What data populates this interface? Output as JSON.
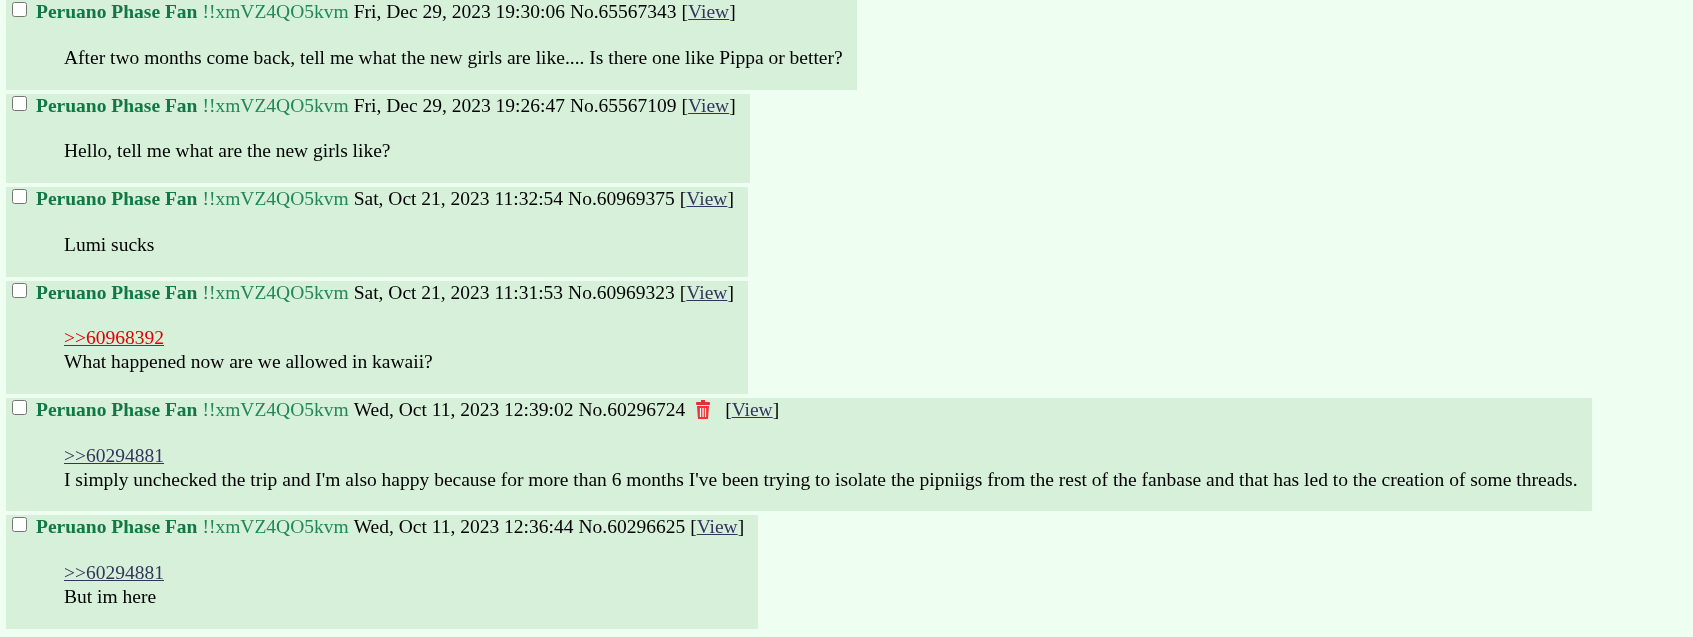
{
  "posts": [
    {
      "checked": false,
      "name": "Peruano Phase Fan",
      "trip": "!!xmVZ4QO5kvm",
      "datetime": "Fri, Dec 29, 2023 19:30:06",
      "number": "No.65567343",
      "deleted": false,
      "view": {
        "open": "[",
        "label": "View",
        "close": "]"
      },
      "message": "After two months come back, tell me what the new girls are like.... Is there one like Pippa or better?"
    },
    {
      "checked": false,
      "name": "Peruano Phase Fan",
      "trip": "!!xmVZ4QO5kvm",
      "datetime": "Fri, Dec 29, 2023 19:26:47",
      "number": "No.65567109",
      "deleted": false,
      "view": {
        "open": "[",
        "label": "View",
        "close": "]"
      },
      "message": "Hello, tell me what are the new girls like?"
    },
    {
      "checked": false,
      "name": "Peruano Phase Fan",
      "trip": "!!xmVZ4QO5kvm",
      "datetime": "Sat, Oct 21, 2023 11:32:54",
      "number": "No.60969375",
      "deleted": false,
      "view": {
        "open": "[",
        "label": "View",
        "close": "]"
      },
      "message": "Lumi sucks"
    },
    {
      "checked": false,
      "name": "Peruano Phase Fan",
      "trip": "!!xmVZ4QO5kvm",
      "datetime": "Sat, Oct 21, 2023 11:31:53",
      "number": "No.60969323",
      "deleted": false,
      "view": {
        "open": "[",
        "label": "View",
        "close": "]"
      },
      "quotes": [
        {
          "text": ">>60968392",
          "dead": true
        }
      ],
      "message": "What happened now are we allowed in kawaii?"
    },
    {
      "checked": false,
      "name": "Peruano Phase Fan",
      "trip": "!!xmVZ4QO5kvm",
      "datetime": "Wed, Oct 11, 2023 12:39:02",
      "number": "No.60296724",
      "deleted": true,
      "view": {
        "open": "[",
        "label": "View",
        "close": "]"
      },
      "quotes": [
        {
          "text": ">>60294881",
          "dead": false
        }
      ],
      "message": "I simply unchecked the trip and I'm also happy because for more than 6 months I've been trying to isolate the pipniigs from the rest of the fanbase and that has led to the creation of some threads."
    },
    {
      "checked": false,
      "name": "Peruano Phase Fan",
      "trip": "!!xmVZ4QO5kvm",
      "datetime": "Wed, Oct 11, 2023 12:36:44",
      "number": "No.60296625",
      "deleted": false,
      "view": {
        "open": "[",
        "label": "View",
        "close": "]"
      },
      "quotes": [
        {
          "text": ">>60294881",
          "dead": false
        }
      ],
      "message": "But im here"
    }
  ]
}
